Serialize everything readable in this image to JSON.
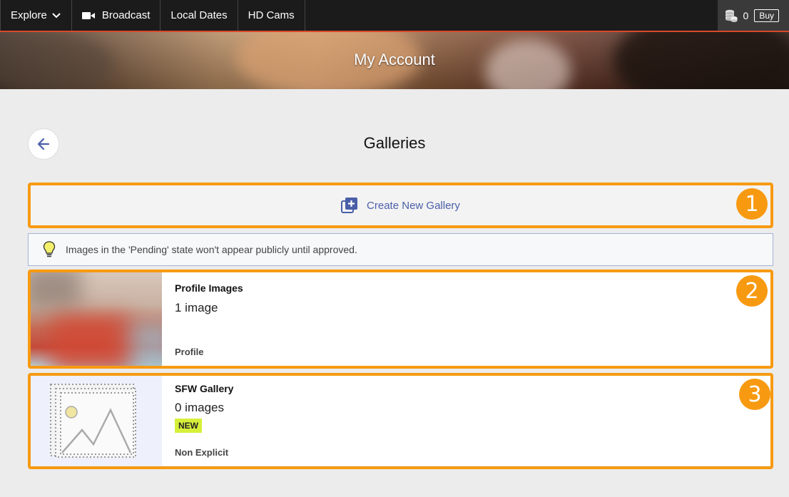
{
  "nav": {
    "explore_label": "Explore",
    "broadcast_label": "Broadcast",
    "local_dates_label": "Local Dates",
    "hd_cams_label": "HD Cams",
    "coins": "0",
    "buy_label": "Buy"
  },
  "hero": {
    "title": "My Account"
  },
  "page": {
    "title": "Galleries"
  },
  "create": {
    "label": "Create New Gallery"
  },
  "info": {
    "text": "Images in the 'Pending' state won't appear publicly until approved."
  },
  "annotations": {
    "badge1": "1",
    "badge2": "2",
    "badge3": "3"
  },
  "galleries": [
    {
      "title": "Profile Images",
      "count": "1 image",
      "type": "Profile"
    },
    {
      "title": "SFW Gallery",
      "count": "0 images",
      "tag": "NEW",
      "type": "Non Explicit"
    }
  ],
  "colors": {
    "accent": "#f79a12",
    "nav_bg": "#1b1b1b",
    "link": "#4a5fa8",
    "new_tag": "#d6f03a"
  }
}
